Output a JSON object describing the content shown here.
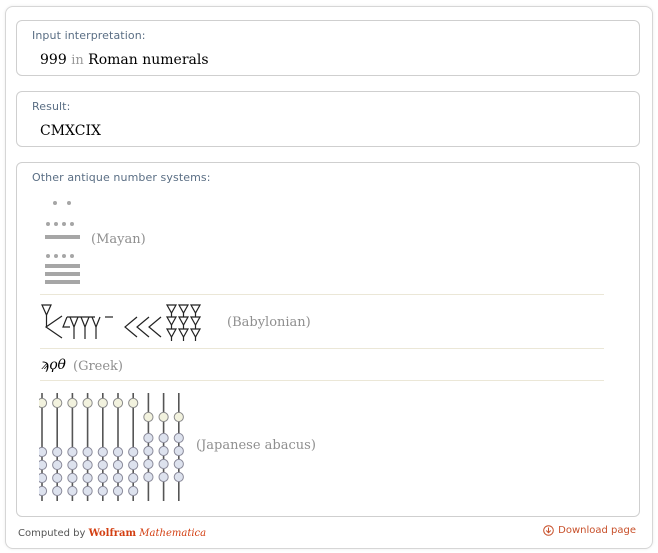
{
  "input_pod": {
    "title": "Input interpretation:",
    "number": "999",
    "connector": "in",
    "system": "Roman numerals"
  },
  "result_pod": {
    "title": "Result:",
    "value": "CMXCIX"
  },
  "other_pod": {
    "title": "Other antique number systems:",
    "mayan_label": "(Mayan)",
    "babylonian_label": "(Babylonian)",
    "greek_numeral": "ϡϙθ",
    "greek_label": "(Greek)",
    "abacus_label": "(Japanese abacus)"
  },
  "footer": {
    "computed_by": "Computed by",
    "wolfram": "Wolfram",
    "mathematica": "Mathematica",
    "download": "Download page"
  }
}
